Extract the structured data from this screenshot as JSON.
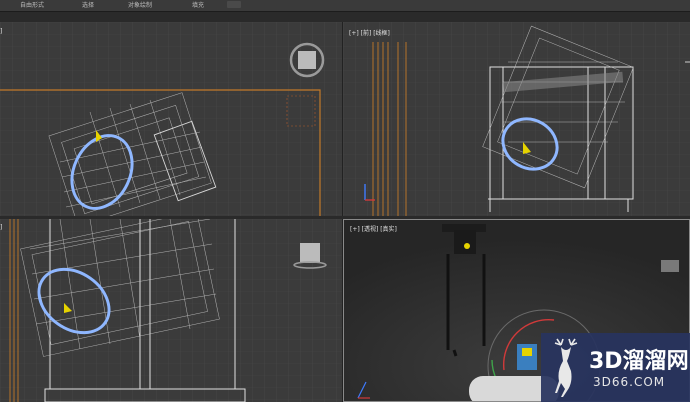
{
  "menu": {
    "items": [
      "自由形式",
      "选择",
      "对象绘制",
      "填充"
    ],
    "view_icon": "view-dropdown-icon"
  },
  "viewports": {
    "top_left": {
      "label": "[+] [顶]",
      "partial_label": "]"
    },
    "top_right": {
      "label": "[+] [前] [线框]"
    },
    "bottom_left": {
      "label": "]"
    },
    "bottom_right": {
      "label": "[+] [透视] [真实]"
    }
  },
  "watermark": {
    "brand": "3D溜溜网",
    "url": "3D66.COM",
    "logo_icon": "deer-logo-icon"
  },
  "colors": {
    "viewport_bg": "#3b3b3b",
    "perspective_bg": "#2f2f2f",
    "grid": "#4a4a4a",
    "wire": "#c9c9c9",
    "orange": "#c27a2a",
    "ring": "#8fb7ff",
    "watermark_bg": "#28345f"
  }
}
